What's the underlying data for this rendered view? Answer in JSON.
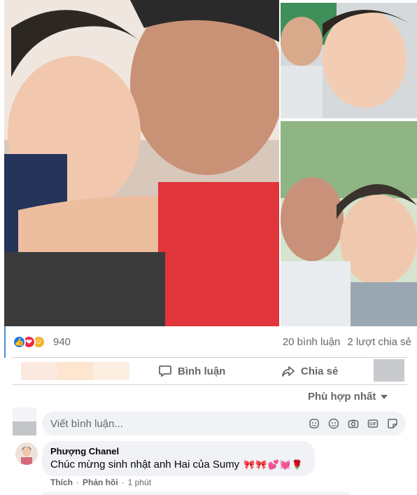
{
  "post": {
    "reactions": {
      "count": "940",
      "types": [
        "like-icon",
        "love-icon",
        "care-icon"
      ]
    },
    "stats": {
      "comments": "20 bình luận",
      "shares": "2 lượt chia sẻ"
    },
    "actions": {
      "comment_label": "Bình luận",
      "share_label": "Chia sẻ"
    }
  },
  "comments_section": {
    "sort_label": "Phù hợp nhất",
    "composer_placeholder": "Viết bình luận...",
    "composer_icons": [
      "sticker-face-icon",
      "emoji-icon",
      "camera-icon",
      "gif-icon",
      "sticker-icon"
    ],
    "comments": [
      {
        "author": "Phượng Chanel",
        "text": "Chúc mừng sinh nhật anh Hai của Sumy",
        "emoji": "🎀🎀💕💓🌹",
        "like_label": "Thích",
        "reply_label": "Phản hồi",
        "time": "1 phút"
      }
    ]
  },
  "colors": {
    "accent": "#1877f2",
    "muted_text": "#65676b",
    "bubble_bg": "#f0f2f5"
  }
}
